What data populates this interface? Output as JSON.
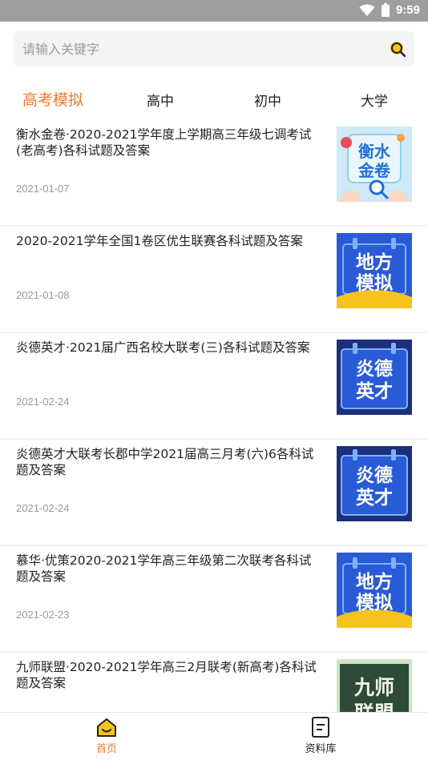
{
  "status_bar": {
    "time": "9:59"
  },
  "search": {
    "placeholder": "请输入关键字"
  },
  "tabs": [
    {
      "label": "高考模拟",
      "active": true
    },
    {
      "label": "高中",
      "active": false
    },
    {
      "label": "初中",
      "active": false
    },
    {
      "label": "大学",
      "active": false
    }
  ],
  "items": [
    {
      "title": "衡水金卷·2020-2021学年度上学期高三年级七调考试(老高考)各科试题及答案",
      "date": "2021-01-07",
      "thumb_text": [
        "衡水",
        "金卷"
      ]
    },
    {
      "title": "2020-2021学年全国1卷区优生联赛各科试题及答案",
      "date": "2021-01-08",
      "thumb_text": [
        "地方",
        "模拟"
      ]
    },
    {
      "title": "炎德英才·2021届广西名校大联考(三)各科试题及答案",
      "date": "2021-02-24",
      "thumb_text": [
        "炎德",
        "英才"
      ]
    },
    {
      "title": "炎德英才大联考长郡中学2021届高三月考(六)6各科试题及答案",
      "date": "2021-02-24",
      "thumb_text": [
        "炎德",
        "英才"
      ]
    },
    {
      "title": "慕华·优策2020-2021学年高三年级第二次联考各科试题及答案",
      "date": "2021-02-23",
      "thumb_text": [
        "地方",
        "模拟"
      ]
    },
    {
      "title": "九师联盟·2020-2021学年高三2月联考(新高考)各科试题及答案",
      "date": "",
      "thumb_text": [
        "九师",
        "联盟"
      ]
    }
  ],
  "bottom_nav": {
    "home_label": "首页",
    "library_label": "资料库"
  },
  "colors": {
    "accent": "#f07a2c",
    "thumb_blue": "#2a5bd7",
    "thumb_yellow": "#f6c31c"
  }
}
